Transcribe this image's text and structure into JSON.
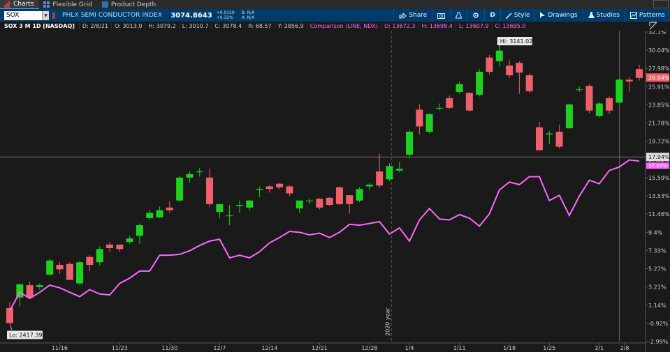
{
  "tabs": [
    {
      "label": "Charts",
      "active": true
    },
    {
      "label": "Flexible Grid",
      "active": false
    },
    {
      "label": "Product Depth",
      "active": false
    }
  ],
  "toolbar": {
    "symbol": "SOX",
    "symbol_name": "PHLX SEMI CONDUCTOR INDEX",
    "last_price": "3074.8643",
    "change": "+9.9159",
    "change_pct": "+0.32%",
    "bid": "B: N/A",
    "ask": "A: N/A",
    "share_label": "Share",
    "aggregation": "D",
    "style_label": "Style",
    "drawings_label": "Drawings",
    "studies_label": "Studies",
    "patterns_label": "Patterns"
  },
  "info": {
    "title": "SOX 3 M 1D [NASDAQ]",
    "date": "D: 2/8/21",
    "open": "O: 3013.0",
    "high": "H: 3079.2",
    "low": "L: 3010.7",
    "close": "C: 3078.4",
    "range": "R: 68.57",
    "y": "Y: 2856.9",
    "comparison": "Comparison (LINE, NDX)",
    "cmp_open": "O: 13672.3",
    "cmp_high": "H: 13698.4",
    "cmp_low": "L: 13607.9",
    "cmp_close": "C: 13695.0"
  },
  "colors": {
    "up": "#1fd11f",
    "down": "#f0606a",
    "comparison": "#ff66ff",
    "background": "#1a1a1a",
    "toolbar": "#003c6b"
  },
  "chart_data": {
    "type": "candlestick",
    "y_axis_unit": "percent",
    "y_ticks": [
      "32.1%",
      "30.04%",
      "27.98%",
      "25.91%",
      "23.85%",
      "21.78%",
      "19.72%",
      "17.65%",
      "15.59%",
      "13.53%",
      "11.46%",
      "9.4%",
      "7.33%",
      "5.27%",
      "3.21%",
      "1.14%",
      "-0.92%",
      "-2.99%"
    ],
    "x_ticks": [
      "11/16",
      "11/23",
      "11/30",
      "12/7",
      "12/14",
      "12/21",
      "12/28",
      "1/4",
      "1/11",
      "1/18",
      "1/25",
      "2/1",
      "2/8"
    ],
    "year_marker": "2020 year",
    "hi_label": "Hi: 3141.02",
    "lo_label": "Lo: 2417.39",
    "last_badge": "26.94%",
    "cmp_badge": "17.94%",
    "cmp_badge2": "17.47%",
    "ylim": [
      -2.99,
      32.1
    ],
    "candles": [
      {
        "o": 0.8,
        "h": 1.5,
        "l": -0.8,
        "c": -0.9
      },
      {
        "o": 2.0,
        "h": 3.6,
        "l": 1.0,
        "c": 3.5
      },
      {
        "o": 3.4,
        "h": 3.8,
        "l": 2.0,
        "c": 2.0
      },
      {
        "o": 3.2,
        "h": 3.6,
        "l": 2.9,
        "c": 3.4
      },
      {
        "o": 4.6,
        "h": 6.4,
        "l": 4.5,
        "c": 6.2
      },
      {
        "o": 5.7,
        "h": 6.0,
        "l": 4.7,
        "c": 5.2
      },
      {
        "o": 5.8,
        "h": 6.0,
        "l": 4.0,
        "c": 4.0
      },
      {
        "o": 3.6,
        "h": 6.2,
        "l": 3.4,
        "c": 6.0
      },
      {
        "o": 6.6,
        "h": 6.8,
        "l": 5.0,
        "c": 5.7
      },
      {
        "o": 6.0,
        "h": 7.8,
        "l": 5.6,
        "c": 7.5
      },
      {
        "o": 8.0,
        "h": 8.3,
        "l": 7.2,
        "c": 7.6
      },
      {
        "o": 8.0,
        "h": 7.8,
        "l": 7.2,
        "c": 7.5
      },
      {
        "o": 8.3,
        "h": 9.0,
        "l": 8.1,
        "c": 8.7
      },
      {
        "o": 9.0,
        "h": 10.4,
        "l": 8.1,
        "c": 10.2
      },
      {
        "o": 11.0,
        "h": 11.9,
        "l": 10.8,
        "c": 11.6
      },
      {
        "o": 11.1,
        "h": 12.3,
        "l": 11.0,
        "c": 11.9
      },
      {
        "o": 12.2,
        "h": 12.9,
        "l": 11.6,
        "c": 11.9
      },
      {
        "o": 13.0,
        "h": 15.8,
        "l": 12.8,
        "c": 15.6
      },
      {
        "o": 15.6,
        "h": 16.3,
        "l": 15.0,
        "c": 16.0
      },
      {
        "o": 16.2,
        "h": 16.7,
        "l": 15.7,
        "c": 16.3
      },
      {
        "o": 15.6,
        "h": 16.6,
        "l": 12.3,
        "c": 12.6
      },
      {
        "o": 11.7,
        "h": 12.3,
        "l": 11.0,
        "c": 12.6
      },
      {
        "o": 11.3,
        "h": 12.5,
        "l": 10.2,
        "c": 11.3
      },
      {
        "o": 12.4,
        "h": 13.0,
        "l": 11.6,
        "c": 12.5
      },
      {
        "o": 12.2,
        "h": 13.1,
        "l": 11.9,
        "c": 13.0
      },
      {
        "o": 14.2,
        "h": 14.6,
        "l": 13.4,
        "c": 14.3
      },
      {
        "o": 14.6,
        "h": 14.8,
        "l": 13.9,
        "c": 14.3
      },
      {
        "o": 14.9,
        "h": 15.0,
        "l": 14.3,
        "c": 14.5
      },
      {
        "o": 14.6,
        "h": 14.7,
        "l": 13.5,
        "c": 13.8
      },
      {
        "o": 12.1,
        "h": 13.0,
        "l": 11.6,
        "c": 13.0
      },
      {
        "o": 13.0,
        "h": 13.2,
        "l": 12.6,
        "c": 13.0
      },
      {
        "o": 13.2,
        "h": 13.3,
        "l": 12.0,
        "c": 12.2
      },
      {
        "o": 13.3,
        "h": 13.4,
        "l": 12.4,
        "c": 12.5
      },
      {
        "o": 14.5,
        "h": 14.6,
        "l": 12.5,
        "c": 12.6
      },
      {
        "o": 13.6,
        "h": 13.6,
        "l": 11.5,
        "c": 12.6
      },
      {
        "o": 13.0,
        "h": 14.5,
        "l": 12.8,
        "c": 14.3
      },
      {
        "o": 14.6,
        "h": 15.0,
        "l": 14.2,
        "c": 14.8
      },
      {
        "o": 16.3,
        "h": 18.3,
        "l": 14.4,
        "c": 14.7
      },
      {
        "o": 15.4,
        "h": 17.2,
        "l": 15.2,
        "c": 16.9
      },
      {
        "o": 16.4,
        "h": 17.4,
        "l": 16.2,
        "c": 16.6
      },
      {
        "o": 18.2,
        "h": 21.0,
        "l": 17.8,
        "c": 20.8
      },
      {
        "o": 23.3,
        "h": 23.9,
        "l": 20.5,
        "c": 21.4
      },
      {
        "o": 20.8,
        "h": 22.9,
        "l": 20.6,
        "c": 22.8
      },
      {
        "o": 23.5,
        "h": 24.0,
        "l": 23.2,
        "c": 23.5
      },
      {
        "o": 24.6,
        "h": 24.9,
        "l": 23.4,
        "c": 23.5
      },
      {
        "o": 25.3,
        "h": 26.5,
        "l": 25.1,
        "c": 26.2
      },
      {
        "o": 25.2,
        "h": 25.3,
        "l": 23.1,
        "c": 23.2
      },
      {
        "o": 25.0,
        "h": 27.9,
        "l": 24.8,
        "c": 27.6
      },
      {
        "o": 29.2,
        "h": 29.5,
        "l": 27.3,
        "c": 27.6
      },
      {
        "o": 28.8,
        "h": 30.2,
        "l": 28.2,
        "c": 30.0
      },
      {
        "o": 28.3,
        "h": 28.9,
        "l": 26.9,
        "c": 27.2
      },
      {
        "o": 28.6,
        "h": 28.8,
        "l": 25.1,
        "c": 27.5
      },
      {
        "o": 27.2,
        "h": 27.4,
        "l": 25.2,
        "c": 25.4
      },
      {
        "o": 21.3,
        "h": 21.9,
        "l": 18.7,
        "c": 18.7
      },
      {
        "o": 20.5,
        "h": 20.9,
        "l": 19.4,
        "c": 20.6
      },
      {
        "o": 20.8,
        "h": 21.6,
        "l": 18.9,
        "c": 19.1
      },
      {
        "o": 21.2,
        "h": 24.0,
        "l": 21.1,
        "c": 23.9
      },
      {
        "o": 25.6,
        "h": 25.9,
        "l": 25.3,
        "c": 25.6
      },
      {
        "o": 26.0,
        "h": 26.2,
        "l": 22.9,
        "c": 23.2
      },
      {
        "o": 22.6,
        "h": 24.2,
        "l": 22.4,
        "c": 24.0
      },
      {
        "o": 24.6,
        "h": 24.8,
        "l": 22.8,
        "c": 23.2
      },
      {
        "o": 24.1,
        "h": 26.8,
        "l": 24.0,
        "c": 26.7
      },
      {
        "o": 26.7,
        "h": 27.0,
        "l": 25.3,
        "c": 26.5
      },
      {
        "o": 27.9,
        "h": 28.4,
        "l": 26.6,
        "c": 26.9
      }
    ],
    "comparison_series": {
      "name": "NDX",
      "values": [
        0.5,
        2.6,
        1.9,
        2.6,
        3.4,
        3.1,
        2.6,
        2.1,
        2.9,
        2.4,
        2.3,
        3.6,
        4.2,
        5.0,
        5.0,
        6.8,
        6.8,
        6.9,
        7.3,
        7.9,
        8.4,
        8.6,
        6.5,
        6.8,
        6.5,
        7.2,
        8.2,
        8.8,
        9.5,
        9.4,
        9.1,
        9.3,
        8.8,
        9.4,
        10.3,
        10.2,
        10.4,
        10.6,
        9.2,
        9.9,
        8.4,
        10.8,
        12.1,
        10.9,
        10.8,
        11.4,
        11.0,
        10.1,
        11.5,
        14.2,
        15.1,
        14.8,
        15.7,
        15.7,
        13.0,
        13.6,
        11.3,
        13.5,
        15.3,
        14.9,
        16.4,
        16.8,
        17.6,
        17.47
      ]
    }
  }
}
